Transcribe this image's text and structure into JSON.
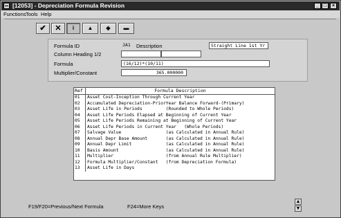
{
  "window": {
    "title": "[12053] - Depreciation Formula Revision",
    "minimize_glyph": "_",
    "maximize_glyph": "□",
    "close_glyph": "×"
  },
  "menu": {
    "items": [
      "Functions",
      "Tools",
      "Help"
    ]
  },
  "toolbar": {
    "buttons": [
      {
        "name": "ok-check",
        "glyph": "✔"
      },
      {
        "name": "cancel",
        "glyph": "✕"
      },
      {
        "name": "inquire",
        "glyph": "i"
      },
      {
        "name": "add",
        "glyph": "▲"
      },
      {
        "name": "change",
        "glyph": "◈"
      },
      {
        "name": "delete",
        "glyph": "▬"
      }
    ]
  },
  "form": {
    "formula_id_label": "Formula ID",
    "formula_id_value": "JA1",
    "description_label": "Description",
    "description_value": "Straight Line 1st Yr",
    "column_heading_label": "Column Heading 1/2",
    "column_heading_1": "",
    "column_heading_2": "",
    "formula_label": "Formula",
    "formula_value": "(16/12)*(10/11)",
    "multiplier_label": "Multiplier/Constant",
    "multiplier_value": "365.000000"
  },
  "list": {
    "headers": [
      "Ref",
      "Formula Description"
    ],
    "rows": [
      {
        "ref": "01",
        "desc": "Asset Cost-Inception Through Current Year"
      },
      {
        "ref": "02",
        "desc": "Accumulated Depreciation-PriorYear Balance Forward-(Primary)"
      },
      {
        "ref": "03",
        "desc": "Asset Life in Periods         (Rounded to Whole Periods)"
      },
      {
        "ref": "04",
        "desc": "Asset Life Periods Elapsed at Beginning of Current Year"
      },
      {
        "ref": "05",
        "desc": "Asset Life Periods Remaining at Beginning of Current Year"
      },
      {
        "ref": "06",
        "desc": "Asset Life Periods in Current Year   (Whole Periods)"
      },
      {
        "ref": "07",
        "desc": "Salvage Value                 (as Calculated in Annual Rule)"
      },
      {
        "ref": "08",
        "desc": "Annual Depr Base Amount       (as Calculated in Annual Rule)"
      },
      {
        "ref": "09",
        "desc": "Annual Depr Limit             (as Calculated in Annual Rule)"
      },
      {
        "ref": "10",
        "desc": "Basis Amount                  (as Calculated in Annual Rule)"
      },
      {
        "ref": "11",
        "desc": "Multiplier                    (from Annual Rule Multiplier)"
      },
      {
        "ref": "12",
        "desc": "Formula Multiplier/Constant   (from Depreciation Formula)"
      },
      {
        "ref": "13",
        "desc": "Asset Life in Days"
      }
    ]
  },
  "status": {
    "keys_left": "F19/F20=Previous/Next Formula",
    "keys_right": "F24=More Keys"
  },
  "colors": {
    "titlebar": "#2a2a2a",
    "window_bg": "#c8c8c8",
    "panel_bg": "#d4d4d4"
  }
}
